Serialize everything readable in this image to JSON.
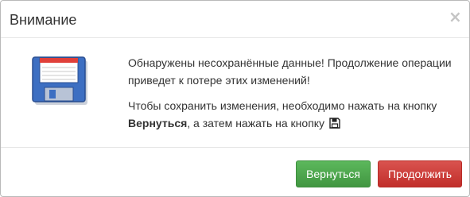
{
  "modal": {
    "title": "Внимание",
    "close_label": "×",
    "icon": "floppy-disk-icon",
    "message_line1": "Обнаружены несохранённые данные! Продолжение операции приведет к потере этих изменений!",
    "message_line2_prefix": "Чтобы сохранить изменения, необходимо нажать на кнопку",
    "message_line2_bold": "Вернуться",
    "message_line2_suffix": ", а затем нажать на кнопку",
    "inline_icon": "save-icon"
  },
  "buttons": {
    "back_label": "Вернуться",
    "continue_label": "Продолжить"
  },
  "colors": {
    "success": "#5cb85c",
    "danger": "#d9534f",
    "floppy_blue": "#3d6fc2",
    "floppy_red": "#e0403a"
  }
}
